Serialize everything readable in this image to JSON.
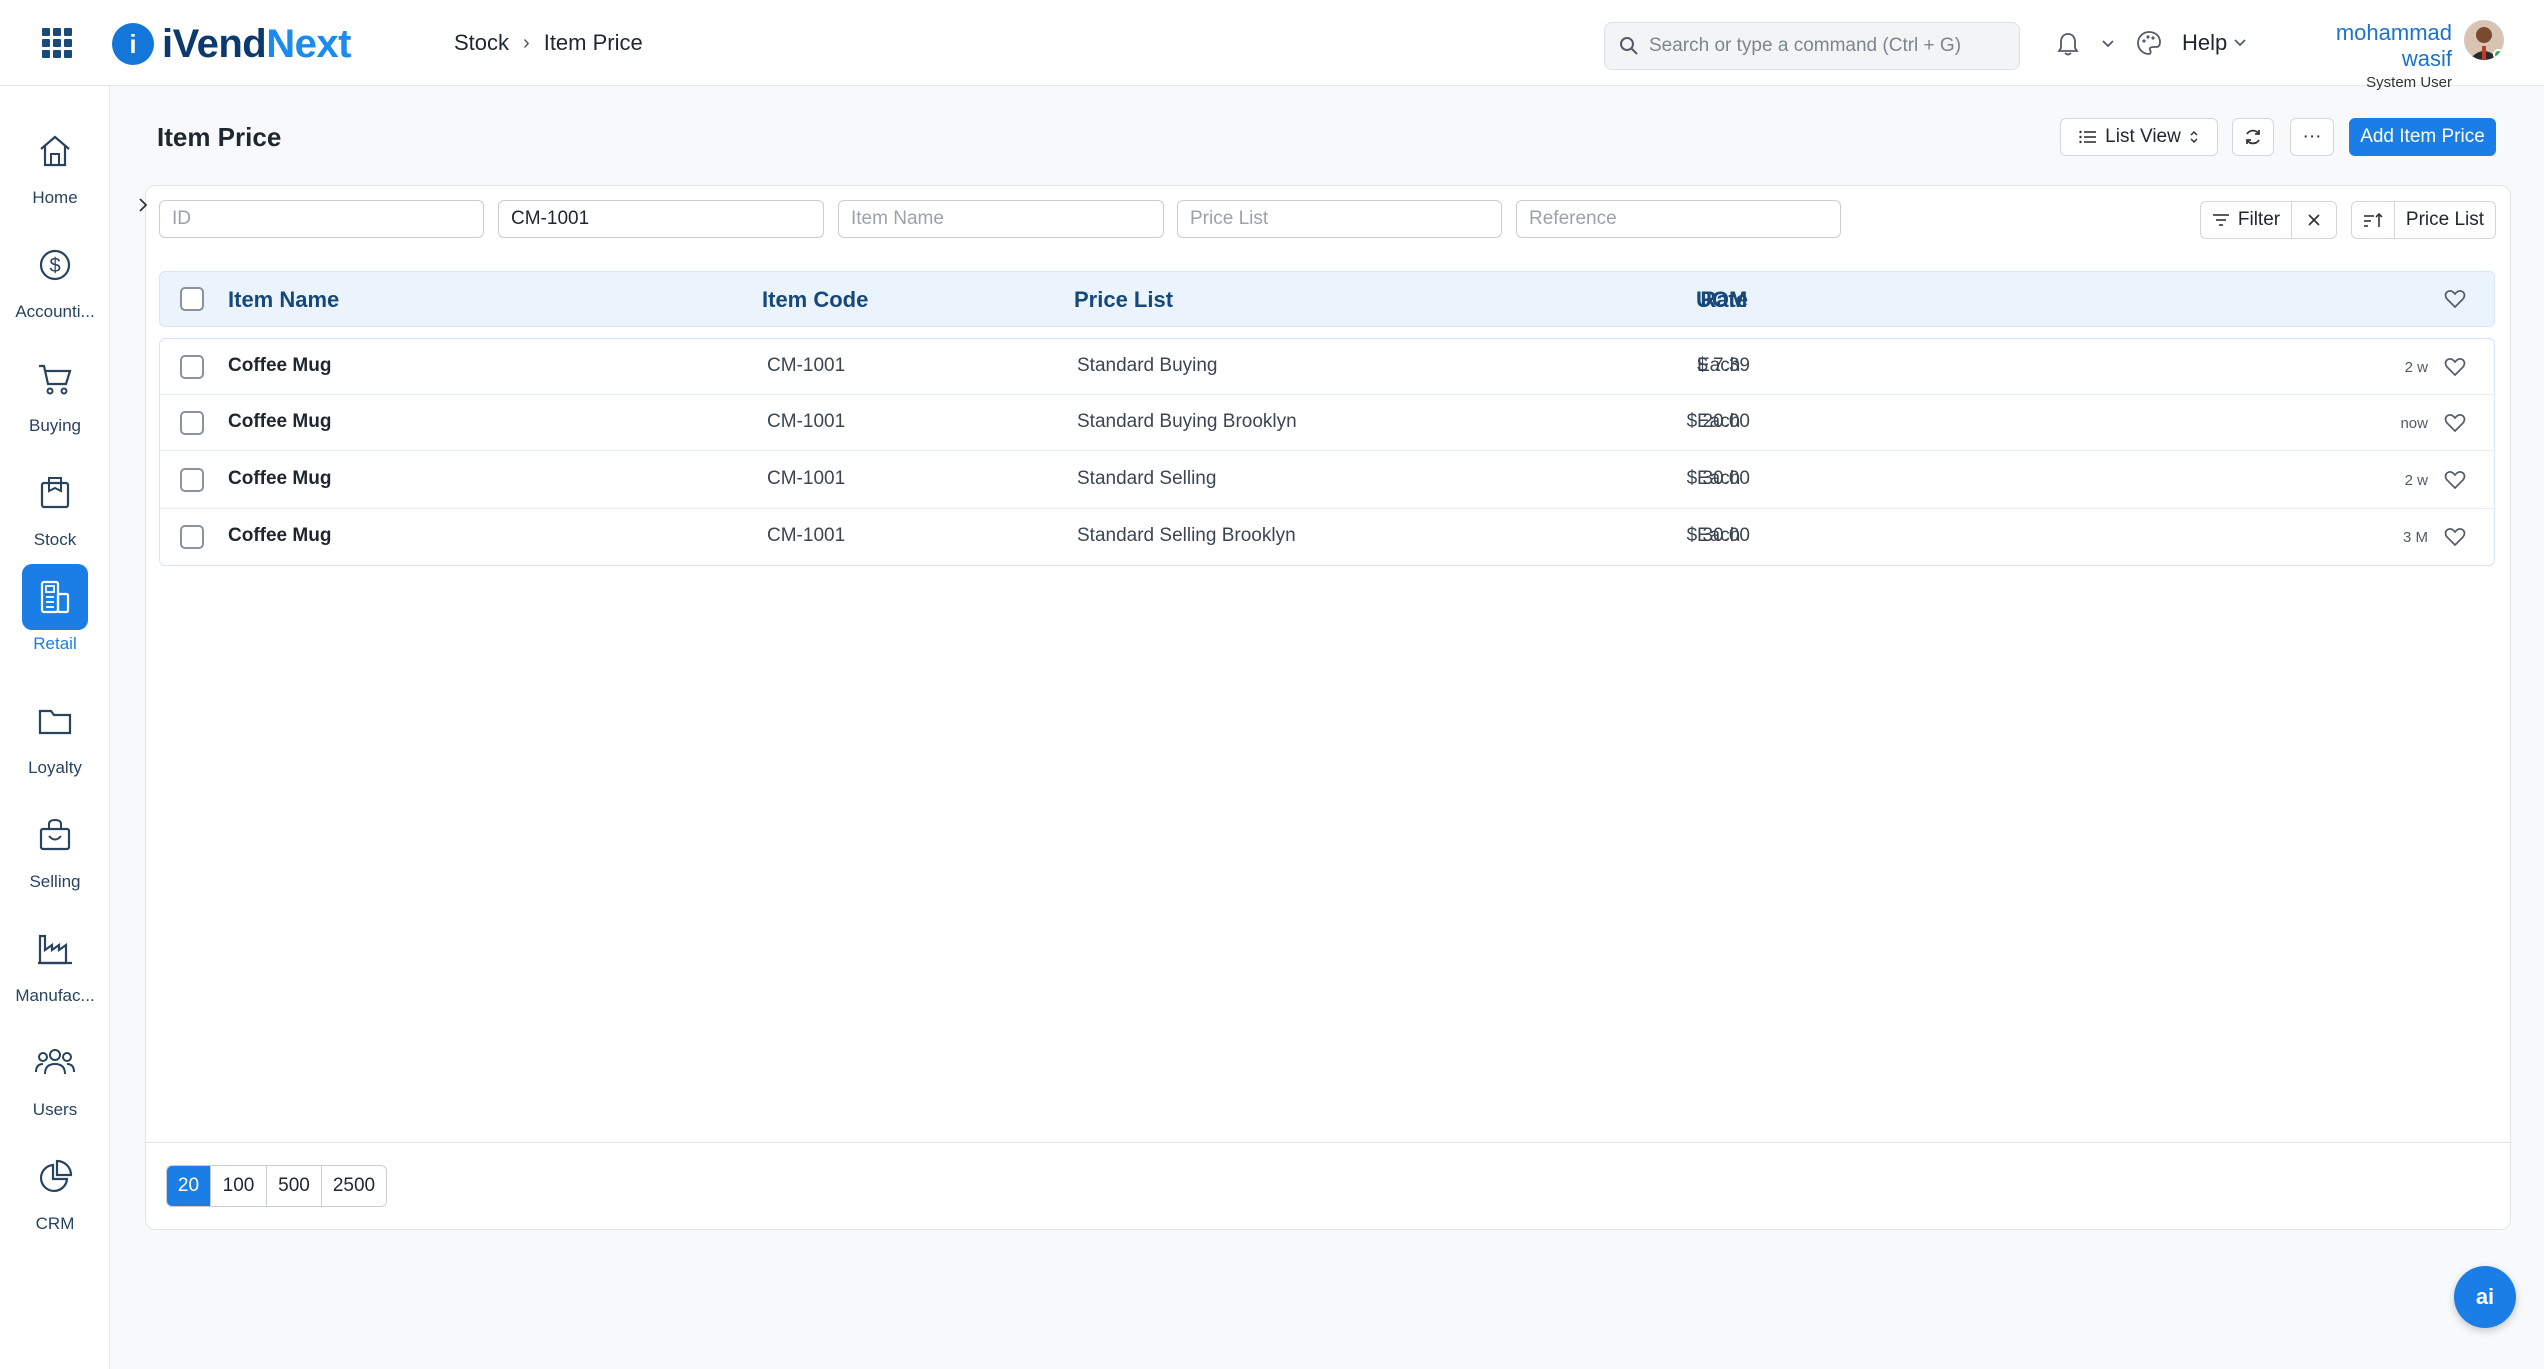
{
  "app": {
    "logo_prefix": "iVend",
    "logo_suffix": "Next",
    "logo_mark": "i"
  },
  "breadcrumb": [
    "Stock",
    "Item Price"
  ],
  "search": {
    "placeholder": "Search or type a command (Ctrl + G)"
  },
  "help_label": "Help",
  "user": {
    "name": "mohammad wasif",
    "role": "System User"
  },
  "sidebar": [
    {
      "label": "Home",
      "icon": "home-icon"
    },
    {
      "label": "Accounti...",
      "icon": "dollar-circle-icon"
    },
    {
      "label": "Buying",
      "icon": "cart-icon"
    },
    {
      "label": "Stock",
      "icon": "box-icon"
    },
    {
      "label": "Retail",
      "icon": "pos-terminal-icon",
      "active": true
    },
    {
      "label": "Loyalty",
      "icon": "folder-icon"
    },
    {
      "label": "Selling",
      "icon": "shopping-bag-icon"
    },
    {
      "label": "Manufac...",
      "icon": "factory-icon"
    },
    {
      "label": "Users",
      "icon": "users-icon"
    },
    {
      "label": "CRM",
      "icon": "pie-chart-icon"
    }
  ],
  "page": {
    "title": "Item Price",
    "list_view_label": "List View",
    "more_label": "···",
    "add_label": "Add Item Price"
  },
  "filters": {
    "id_placeholder": "ID",
    "item_code_value": "CM-1001",
    "item_name_placeholder": "Item Name",
    "price_list_placeholder": "Price List",
    "reference_placeholder": "Reference",
    "filter_label": "Filter",
    "sort_label": "Price List"
  },
  "table": {
    "columns": [
      "Item Name",
      "Item Code",
      "Price List",
      "Rate",
      "UOM"
    ],
    "rows": [
      {
        "item_name": "Coffee Mug",
        "item_code": "CM-1001",
        "price_list": "Standard Buying",
        "rate": "$ 7.39",
        "uom": "Each",
        "modified": "2 w"
      },
      {
        "item_name": "Coffee Mug",
        "item_code": "CM-1001",
        "price_list": "Standard Buying Brooklyn",
        "rate": "$ 20.00",
        "uom": "Each",
        "modified": "now"
      },
      {
        "item_name": "Coffee Mug",
        "item_code": "CM-1001",
        "price_list": "Standard Selling",
        "rate": "$ 30.00",
        "uom": "Each",
        "modified": "2 w"
      },
      {
        "item_name": "Coffee Mug",
        "item_code": "CM-1001",
        "price_list": "Standard Selling Brooklyn",
        "rate": "$ 30.00",
        "uom": "Each",
        "modified": "3 M"
      }
    ]
  },
  "pagination": {
    "options": [
      "20",
      "100",
      "500",
      "2500"
    ],
    "selected": "20"
  },
  "ai_button_label": "ai",
  "colors": {
    "accent": "#1a7ee6",
    "header_bg": "#ebf4fc",
    "header_text": "#17487a"
  }
}
